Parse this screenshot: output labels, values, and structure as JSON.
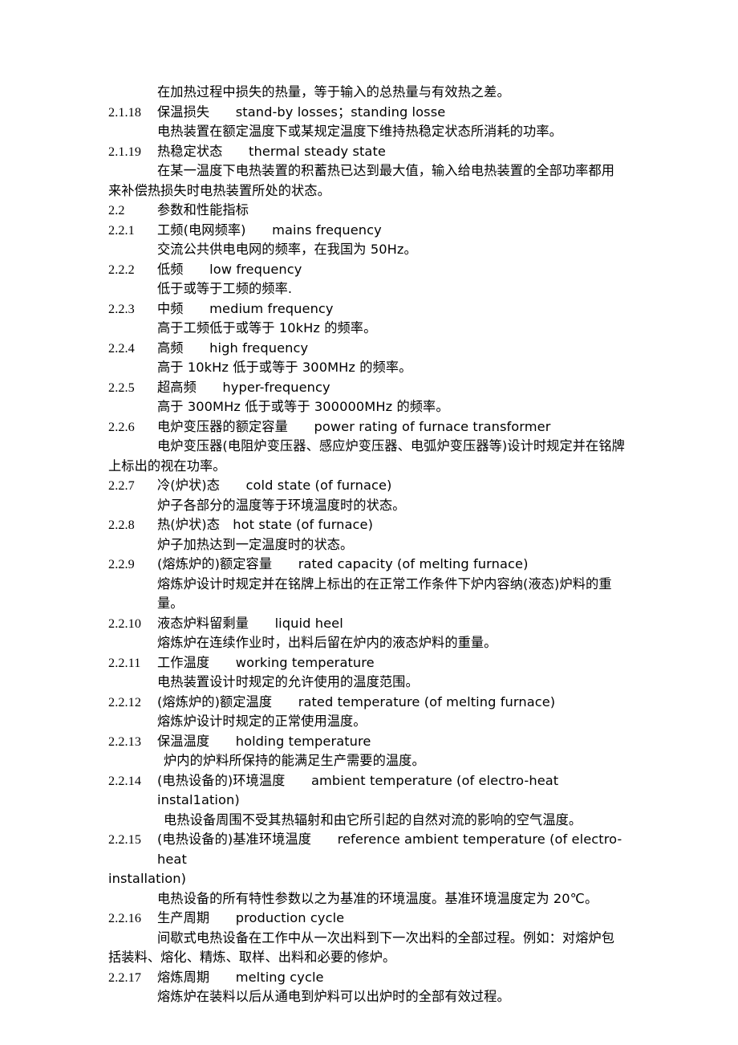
{
  "document": {
    "page_background": "#ffffff",
    "text_color": "#000000",
    "blocks": [
      {
        "kind": "paragraph",
        "indent": "body",
        "text": "在加热过程中损失的热量，等于输入的总热量与有效热之差。"
      },
      {
        "kind": "entry",
        "number": "2.1.18",
        "term": "保温损失　　stand-by losses；standing losse"
      },
      {
        "kind": "paragraph",
        "indent": "body",
        "text": "电热装置在额定温度下或某规定温度下维持热稳定状态所消耗的功率。"
      },
      {
        "kind": "entry",
        "number": "2.1.19",
        "term": "热稳定状态　　thermal steady state"
      },
      {
        "kind": "paragraph",
        "indent": "body",
        "text": "在某一温度下电热装置的积蓄热已达到最大值，输入给电热装置的全部功率都用"
      },
      {
        "kind": "paragraph",
        "indent": "hang",
        "text": "来补偿热损失时电热装置所处的状态。"
      },
      {
        "kind": "entry",
        "number": "2.2",
        "term": "参数和性能指标"
      },
      {
        "kind": "entry",
        "number": "2.2.1",
        "term": "工频(电网频率)　　mains frequency"
      },
      {
        "kind": "paragraph",
        "indent": "body",
        "text": "交流公共供电电网的频率，在我国为 50Hz。"
      },
      {
        "kind": "entry",
        "number": "2.2.2",
        "term": "低频　　low frequency"
      },
      {
        "kind": "paragraph",
        "indent": "body",
        "text": "低于或等于工频的频率."
      },
      {
        "kind": "entry",
        "number": "2.2.3",
        "term": "中频　　medium frequency"
      },
      {
        "kind": "paragraph",
        "indent": "body",
        "text": "高于工频低于或等于 10kHz 的频率。"
      },
      {
        "kind": "entry",
        "number": "2.2.4",
        "term": "高频　　high frequency"
      },
      {
        "kind": "paragraph",
        "indent": "body",
        "text": "高于 10kHz 低于或等于 300MHz 的频率。"
      },
      {
        "kind": "entry",
        "number": "2.2.5",
        "term": "超高频　　hyper-frequency"
      },
      {
        "kind": "paragraph",
        "indent": "body",
        "text": "高于 300MHz 低于或等于 300000MHz 的频率。"
      },
      {
        "kind": "entry",
        "number": "2.2.6",
        "term": "电炉变压器的额定容量　　power rating of furnace transformer"
      },
      {
        "kind": "paragraph",
        "indent": "body",
        "text": "电炉变压器(电阻炉变压器、感应炉变压器、电弧炉变压器等)设计时规定并在铭牌"
      },
      {
        "kind": "paragraph",
        "indent": "hang",
        "text": "上标出的视在功率。"
      },
      {
        "kind": "entry",
        "number": "2.2.7",
        "term": "冷(炉状)态　　cold state (of furnace)"
      },
      {
        "kind": "paragraph",
        "indent": "body",
        "text": "炉子各部分的温度等于环境温度时的状态。"
      },
      {
        "kind": "entry",
        "number": "2.2.8",
        "term": "热(炉状)态　hot state (of furnace)"
      },
      {
        "kind": "paragraph",
        "indent": "body",
        "text": "炉子加热达到一定温度时的状态。"
      },
      {
        "kind": "entry",
        "number": "2.2.9",
        "term": "(熔炼炉的)额定容量　　rated capacity (of melting furnace)"
      },
      {
        "kind": "paragraph",
        "indent": "body",
        "text": "熔炼炉设计时规定并在铭牌上标出的在正常工作条件下炉内容纳(液态)炉料的重量。"
      },
      {
        "kind": "entry",
        "number": "2.2.10",
        "term": "液态炉料留剩量　　liquid heel"
      },
      {
        "kind": "paragraph",
        "indent": "body",
        "text": "熔炼炉在连续作业时，出料后留在炉内的液态炉料的重量。"
      },
      {
        "kind": "entry",
        "number": "2.2.11",
        "term": "工作温度　　working temperature"
      },
      {
        "kind": "paragraph",
        "indent": "body",
        "text": "电热装置设计时规定的允许使用的温度范围。"
      },
      {
        "kind": "entry",
        "number": "2.2.12",
        "term": "(熔炼炉的)额定温度　　rated temperature (of melting furnace)"
      },
      {
        "kind": "paragraph",
        "indent": "body",
        "text": "熔炼炉设计时规定的正常使用温度。"
      },
      {
        "kind": "entry",
        "number": "2.2.13",
        "term": "保温温度　　holding temperature"
      },
      {
        "kind": "paragraph",
        "indent": "body-extra",
        "text": "炉内的炉料所保持的能满足生产需要的温度。"
      },
      {
        "kind": "entry",
        "number": "2.2.14",
        "term": "(电热设备的)环境温度　　ambient temperature (of electro-heat instal1ation)"
      },
      {
        "kind": "paragraph",
        "indent": "body-extra",
        "text": "电热设备周围不受其热辐射和由它所引起的自然对流的影响的空气温度。"
      },
      {
        "kind": "entry",
        "number": "2.2.15",
        "term": "(电热设备的)基准环境温度　　reference ambient temperature (of electro-heat"
      },
      {
        "kind": "paragraph",
        "indent": "hang",
        "text": "installation)"
      },
      {
        "kind": "paragraph",
        "indent": "body",
        "text": "电热设备的所有特性参数以之为基准的环境温度。基准环境温度定为 20℃。"
      },
      {
        "kind": "entry",
        "number": "2.2.16",
        "term": "生产周期　　production cycle"
      },
      {
        "kind": "paragraph",
        "indent": "body",
        "text": "间歇式电热设备在工作中从一次出料到下一次出料的全部过程。例如：对熔炉包"
      },
      {
        "kind": "paragraph",
        "indent": "hang",
        "text": "括装料、熔化、精炼、取样、出料和必要的修炉。"
      },
      {
        "kind": "entry",
        "number": "2.2.17",
        "term": "熔炼周期　　melting cycle"
      },
      {
        "kind": "paragraph",
        "indent": "body",
        "text": "熔炼炉在装料以后从通电到炉料可以出炉时的全部有效过程。"
      }
    ]
  }
}
